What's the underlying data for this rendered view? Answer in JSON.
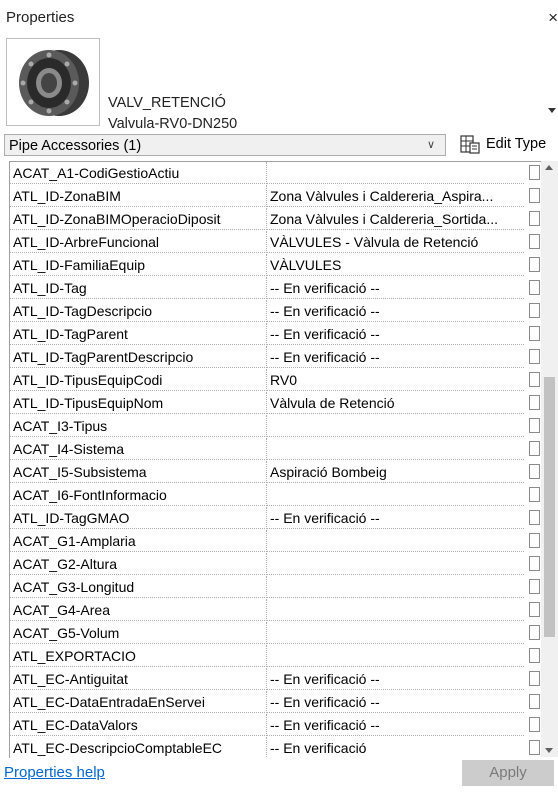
{
  "window": {
    "title": "Properties",
    "close_label": "×"
  },
  "type_selector": {
    "name": "VALV_RETENCIÓ",
    "subtype": "Valvula-RV0-DN250",
    "icon": "valve-icon"
  },
  "filter": {
    "selected": "Pipe Accessories (1)",
    "edit_type_label": "Edit Type"
  },
  "parameters": [
    {
      "name": "ACAT_A1-CodiGestioActiu",
      "value": ""
    },
    {
      "name": "ATL_ID-ZonaBIM",
      "value": "Zona Vàlvules i Caldereria_Aspira..."
    },
    {
      "name": "ATL_ID-ZonaBIMOperacioDiposit",
      "value": "Zona Vàlvules i Caldereria_Sortida..."
    },
    {
      "name": "ATL_ID-ArbreFuncional",
      "value": "VÀLVULES - Vàlvula de Retenció"
    },
    {
      "name": "ATL_ID-FamiliaEquip",
      "value": "VÀLVULES"
    },
    {
      "name": "ATL_ID-Tag",
      "value": "-- En verificació --"
    },
    {
      "name": "ATL_ID-TagDescripcio",
      "value": "-- En verificació --"
    },
    {
      "name": "ATL_ID-TagParent",
      "value": "-- En verificació --"
    },
    {
      "name": "ATL_ID-TagParentDescripcio",
      "value": "-- En verificació --"
    },
    {
      "name": "ATL_ID-TipusEquipCodi",
      "value": "RV0"
    },
    {
      "name": "ATL_ID-TipusEquipNom",
      "value": "Vàlvula de Retenció"
    },
    {
      "name": "ACAT_I3-Tipus",
      "value": ""
    },
    {
      "name": "ACAT_I4-Sistema",
      "value": ""
    },
    {
      "name": "ACAT_I5-Subsistema",
      "value": "Aspiració Bombeig"
    },
    {
      "name": "ACAT_I6-FontInformacio",
      "value": ""
    },
    {
      "name": "ATL_ID-TagGMAO",
      "value": "-- En verificació --"
    },
    {
      "name": "ACAT_G1-Amplaria",
      "value": ""
    },
    {
      "name": "ACAT_G2-Altura",
      "value": ""
    },
    {
      "name": "ACAT_G3-Longitud",
      "value": ""
    },
    {
      "name": "ACAT_G4-Area",
      "value": ""
    },
    {
      "name": "ACAT_G5-Volum",
      "value": ""
    },
    {
      "name": "ATL_EXPORTACIO",
      "value": ""
    },
    {
      "name": "ATL_EC-Antiguitat",
      "value": "-- En verificació --"
    },
    {
      "name": "ATL_EC-DataEntradaEnServei",
      "value": "-- En verificació --"
    },
    {
      "name": "ATL_EC-DataValors",
      "value": "-- En verificació --"
    },
    {
      "name": "ATL_EC-DescripcioComptableEC",
      "value": "-- En verificació"
    }
  ],
  "footer": {
    "help_link": "Properties help",
    "apply_label": "Apply"
  }
}
